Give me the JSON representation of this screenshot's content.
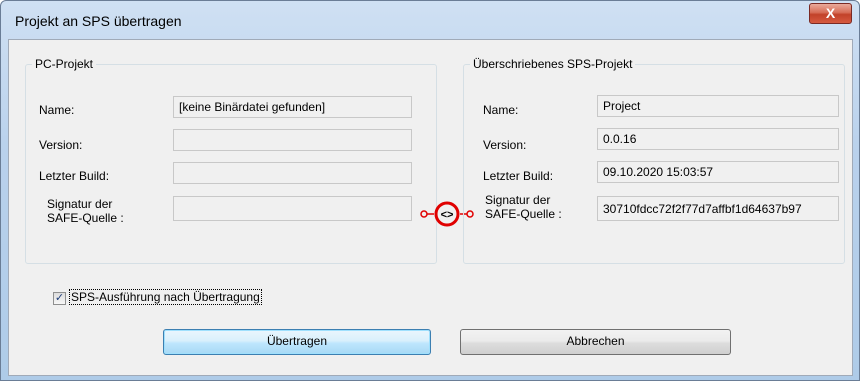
{
  "window": {
    "title": "Projekt an SPS übertragen",
    "close_glyph": "X"
  },
  "pc_project": {
    "title": "PC-Projekt",
    "name_label": "Name:",
    "name_value": "[keine Binärdatei gefunden]",
    "version_label": "Version:",
    "version_value": "",
    "build_label": "Letzter Build:",
    "build_value": "",
    "signature_label_1": "Signatur der",
    "signature_label_2": "SAFE-Quelle :",
    "signature_value": ""
  },
  "sps_project": {
    "title": "Überschriebenes SPS-Projekt",
    "name_label": "Name:",
    "name_value": "Project",
    "version_label": "Version:",
    "version_value": "0.0.16",
    "build_label": "Letzter Build:",
    "build_value": "09.10.2020 15:03:57",
    "signature_label_1": "Signatur der",
    "signature_label_2": "SAFE-Quelle :",
    "signature_value": "30710fdcc72f2f77d7affbf1d64637b97"
  },
  "compare_icon": {
    "glyph": "<>",
    "color": "#e00000"
  },
  "option": {
    "checked": true,
    "label": "SPS-Ausführung nach Übertragung"
  },
  "buttons": {
    "transfer": "Übertragen",
    "cancel": "Abbrechen"
  }
}
